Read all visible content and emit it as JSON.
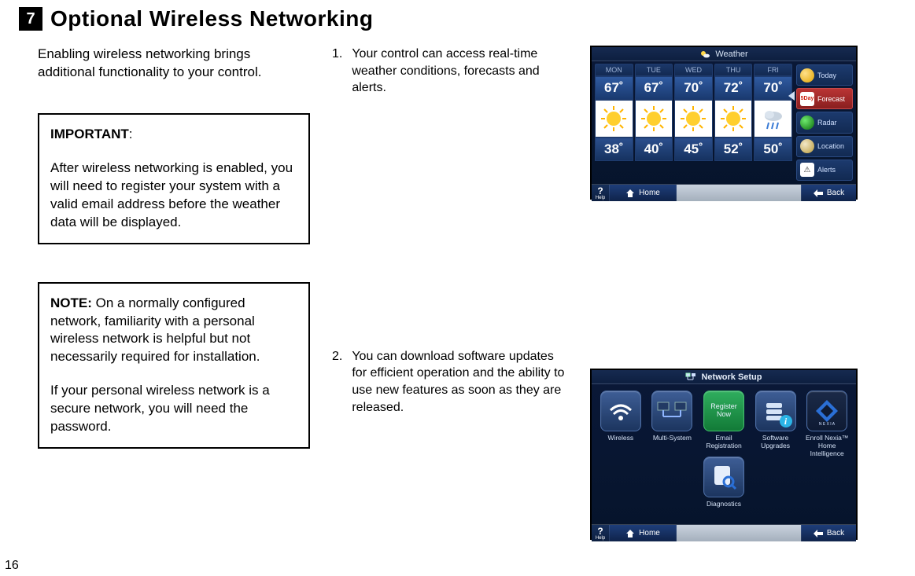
{
  "page_number": "16",
  "header": {
    "section_number": "7",
    "title": "Optional Wireless Networking"
  },
  "intro": "Enabling wireless networking brings additional functionality to your control.",
  "important": {
    "label": "IMPORTANT",
    "body": "After wireless networking is enabled, you will need to register your system with a valid email address before the weather data will be displayed."
  },
  "note": {
    "label": "NOTE:",
    "p1": "On a normally configured network, familiarity with a personal wireless network is helpful but not necessarily required for installation.",
    "p2": "If your personal wireless network is a secure network, you will need the password."
  },
  "steps": [
    {
      "n": "1.",
      "text": "Your control can access real-time weather conditions, forecasts and alerts."
    },
    {
      "n": "2.",
      "text": "You can download software updates for efficient operation and the ability to use new features as soon as they are released."
    }
  ],
  "weather_screen": {
    "title": "Weather",
    "days": [
      "MON",
      "TUE",
      "WED",
      "THU",
      "FRI"
    ],
    "highs": [
      "67˚",
      "67˚",
      "70˚",
      "72˚",
      "70˚"
    ],
    "lows": [
      "38˚",
      "40˚",
      "45˚",
      "52˚",
      "50˚"
    ],
    "menu": {
      "today": "Today",
      "forecast": "Forecast",
      "radar": "Radar",
      "location": "Location",
      "alerts": "Alerts"
    },
    "footer": {
      "help": "Help",
      "home": "Home",
      "back": "Back"
    }
  },
  "network_screen": {
    "title": "Network Setup",
    "tiles": {
      "wireless": "Wireless",
      "multi": "Multi-System",
      "email": "Email Registration",
      "register_btn": "Register\nNow",
      "software": "Software\nUpgrades",
      "nexia": "Enroll Nexia™\nHome Intelligence",
      "diag": "Diagnostics"
    },
    "footer": {
      "help": "Help",
      "home": "Home",
      "back": "Back"
    }
  }
}
